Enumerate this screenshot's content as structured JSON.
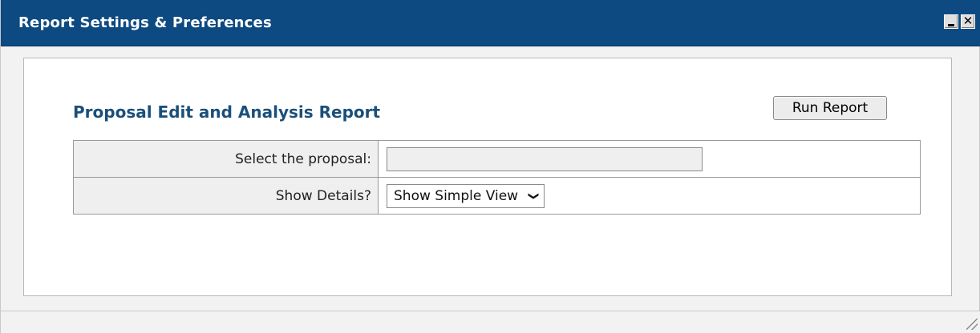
{
  "window": {
    "title": "Report Settings & Preferences",
    "minimize_icon": "minimize-icon",
    "close_icon": "close-icon",
    "close_glyph": "✕",
    "titlebar_color": "#0e4a82"
  },
  "report": {
    "title": "Proposal Edit and Analysis Report",
    "run_button_label": "Run Report"
  },
  "form": {
    "rows": [
      {
        "label": "Select the proposal:",
        "value": ""
      },
      {
        "label": "Show Details?",
        "selected": "Show Simple View"
      }
    ],
    "chevron_icon": "chevron-down-icon"
  }
}
